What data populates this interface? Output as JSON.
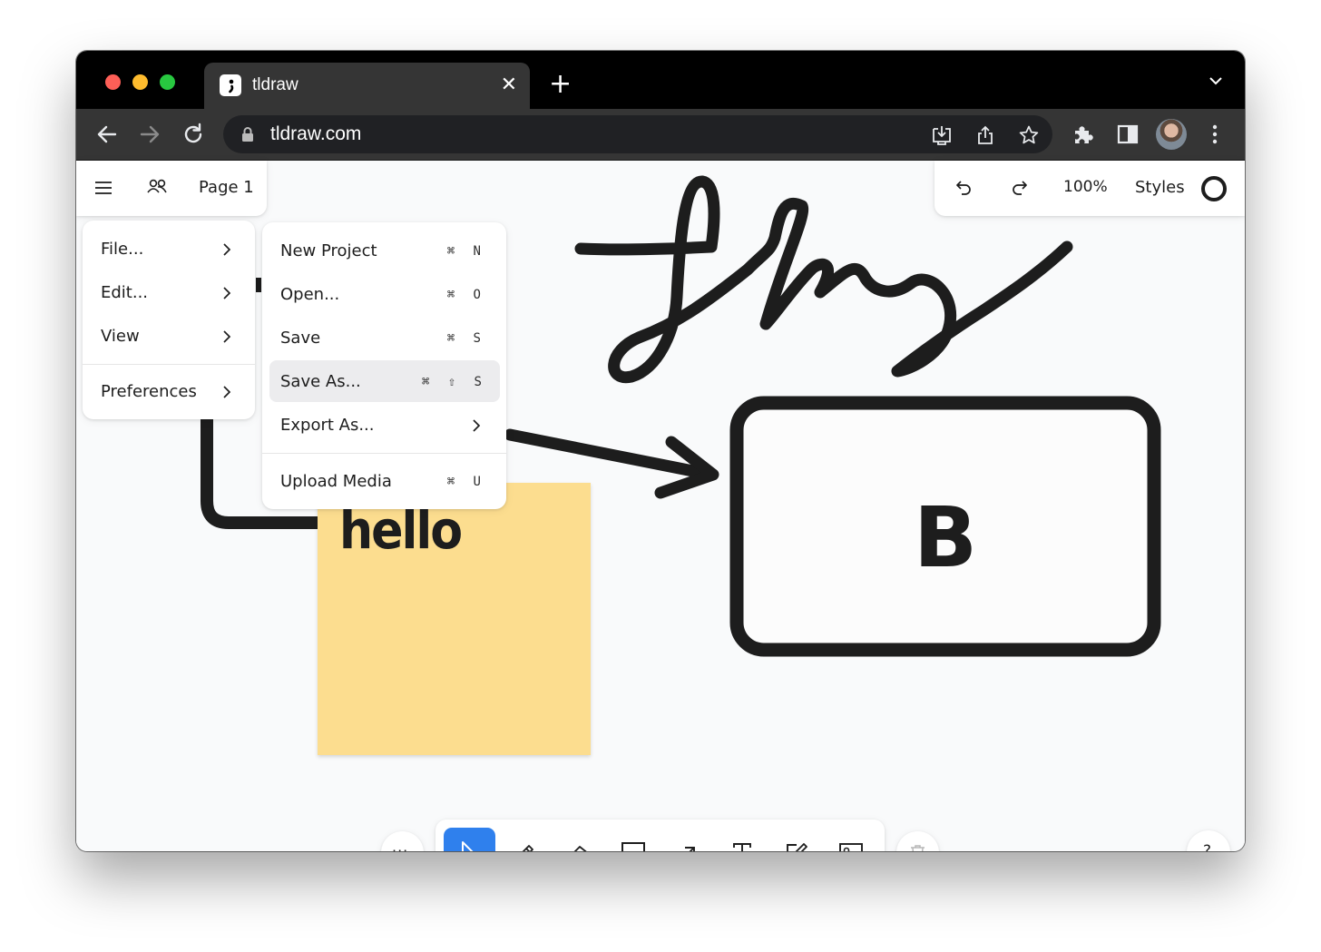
{
  "browser": {
    "tab_title": "tldraw",
    "tab_close": "✕",
    "new_tab": "+",
    "url": "tldraw.com"
  },
  "app": {
    "page_name": "Page 1",
    "zoom": "100%",
    "styles_label": "Styles",
    "help": "?"
  },
  "main_menu": {
    "items": [
      {
        "label": "File..."
      },
      {
        "label": "Edit..."
      },
      {
        "label": "View"
      },
      {
        "label": "Preferences"
      }
    ]
  },
  "file_menu": {
    "items": [
      {
        "label": "New Project",
        "shortcut": "⌘ N"
      },
      {
        "label": "Open...",
        "shortcut": "⌘ O"
      },
      {
        "label": "Save",
        "shortcut": "⌘ S"
      },
      {
        "label": "Save As...",
        "shortcut": "⌘ ⇧ S",
        "highlighted": true
      },
      {
        "label": "Export As..."
      },
      {
        "label": "Upload Media",
        "shortcut": "⌘ U"
      }
    ]
  },
  "canvas": {
    "sticky_text": "hello",
    "rect_text": "B",
    "sticky_color": "#fcdd8f",
    "ink_color": "#1d1d1d"
  },
  "toolbar": {
    "more": "···",
    "active_tool": "select",
    "tools": [
      "select",
      "draw",
      "eraser",
      "rectangle",
      "arrow",
      "text",
      "sticky",
      "image"
    ],
    "accent_color": "#2f80ed"
  }
}
